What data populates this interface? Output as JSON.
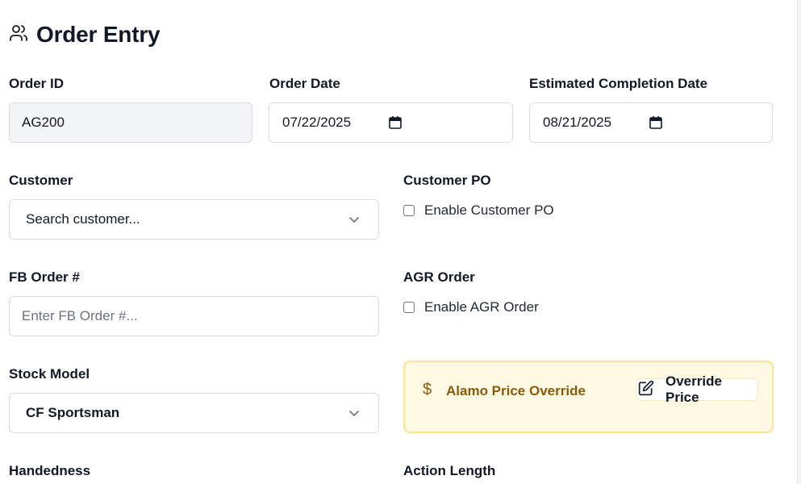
{
  "header": {
    "title": "Order Entry",
    "icon": "users-icon"
  },
  "order_id": {
    "label": "Order ID",
    "value": "AG200"
  },
  "order_date": {
    "label": "Order Date",
    "value": "07/22/2025"
  },
  "completion_date": {
    "label": "Estimated Completion Date",
    "value": "08/21/2025"
  },
  "customer": {
    "label": "Customer",
    "placeholder": "Search customer..."
  },
  "customer_po": {
    "label": "Customer PO",
    "checkbox_label": "Enable Customer PO",
    "checked": false
  },
  "fb_order": {
    "label": "FB Order #",
    "placeholder": "Enter FB Order #..."
  },
  "agr_order": {
    "label": "AGR Order",
    "checkbox_label": "Enable AGR Order",
    "checked": false
  },
  "stock_model": {
    "label": "Stock Model",
    "value": "CF Sportsman"
  },
  "price_override": {
    "icon_glyph": "$",
    "title": "Alamo Price Override",
    "button_label": "Override Price",
    "accent_color": "#8a5a0c",
    "background_color": "#fef9e3"
  },
  "handedness": {
    "label": "Handedness"
  },
  "action_length": {
    "label": "Action Length"
  }
}
